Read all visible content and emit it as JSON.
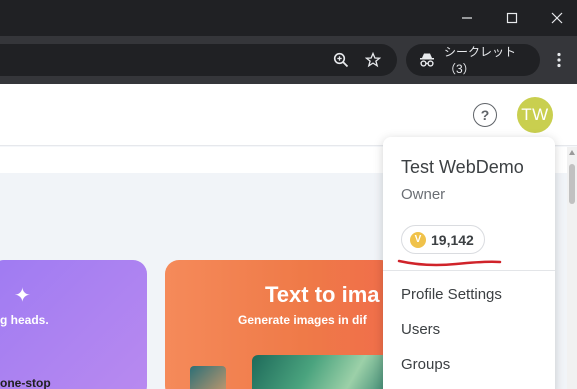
{
  "browser": {
    "incognito_label": "シークレット（3）",
    "icons": {
      "minimize": "minimize-icon",
      "maximize": "maximize-icon",
      "close": "close-icon",
      "zoom": "zoom-icon",
      "bookmark": "star-icon",
      "incognito": "incognito-icon",
      "menu": "kebab-menu-icon"
    }
  },
  "header": {
    "help_icon": "help-icon",
    "help_glyph": "?",
    "avatar_initials": "TW",
    "avatar_color": "#c9cf4f"
  },
  "cards": {
    "left": {
      "subtitle": "g heads.",
      "footer": "one-stop",
      "icon": "sparkle-icon",
      "sparkle_glyph": "✦"
    },
    "right": {
      "title": "Text to ima",
      "subtitle": "Generate images in dif"
    }
  },
  "account_menu": {
    "name": "Test WebDemo",
    "role": "Owner",
    "credits": "19,142",
    "coin_glyph": "V",
    "coin_color": "#f0c24a",
    "annotation_color": "#d0232a",
    "items": [
      {
        "label": "Profile Settings"
      },
      {
        "label": "Users"
      },
      {
        "label": "Groups"
      }
    ]
  }
}
